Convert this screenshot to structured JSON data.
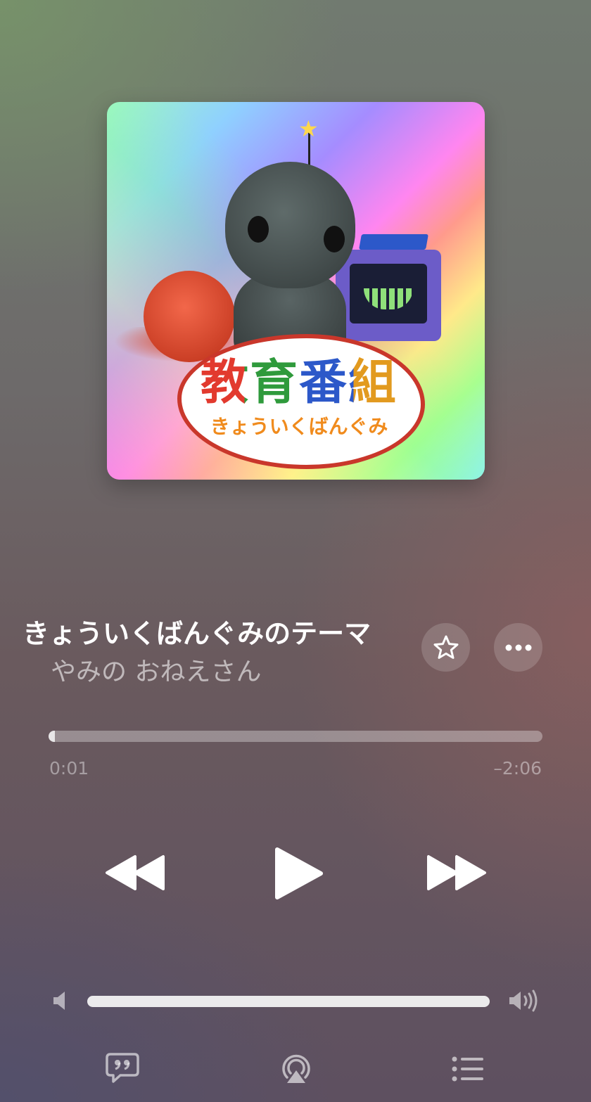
{
  "artwork": {
    "logo_title": "教育番組",
    "logo_subtitle": "きょういくばんぐみ"
  },
  "track": {
    "title": "きょういくばんぐみのテーマ",
    "artist": "やみの おねえさん"
  },
  "playback": {
    "elapsed": "0:01",
    "remaining": "–2:06",
    "progress_percent": 1.3
  },
  "volume": {
    "level_percent": 100
  },
  "icons": {
    "favorite": "star-icon",
    "more": "ellipsis-icon",
    "rewind": "rewind-icon",
    "play": "play-icon",
    "forward": "fast-forward-icon",
    "volume_low": "speaker-low-icon",
    "volume_high": "speaker-high-icon",
    "lyrics": "lyrics-quote-icon",
    "airplay": "airplay-icon",
    "queue": "queue-list-icon"
  },
  "colors": {
    "logo_red": "#e23a2e",
    "logo_green": "#2f9a3c",
    "logo_blue": "#2c58c9",
    "logo_orange": "#e29a1f"
  }
}
